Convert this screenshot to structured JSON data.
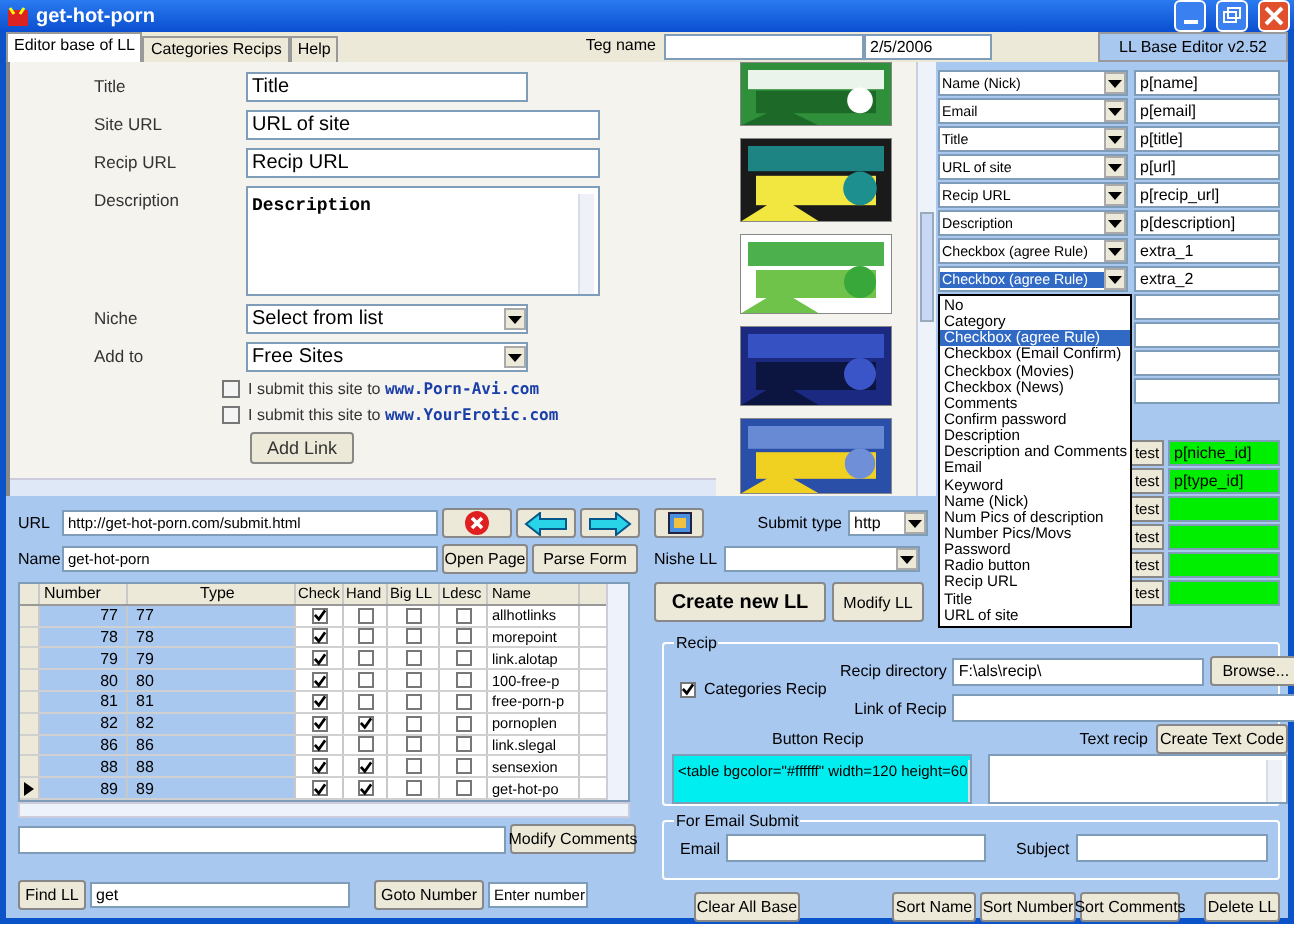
{
  "window": {
    "title": "get-hot-porn"
  },
  "tabs": [
    {
      "label": "Editor base of LL",
      "selected": true
    },
    {
      "label": "Categories Recips",
      "selected": false
    },
    {
      "label": "Help",
      "selected": false
    }
  ],
  "header": {
    "tag_label": "Teg name",
    "date": "2/5/2006",
    "version": "LL Base Editor v2.52"
  },
  "form": {
    "fields": [
      {
        "kind": "input",
        "label": "Title",
        "value": "Title"
      },
      {
        "kind": "wide",
        "label": "Site URL",
        "value": "URL of site"
      },
      {
        "kind": "wide",
        "label": "Recip URL",
        "value": "Recip URL"
      },
      {
        "kind": "textarea",
        "label": "Description",
        "value": "Description"
      },
      {
        "kind": "select",
        "label": "Niche",
        "value": "Select from list"
      },
      {
        "kind": "select",
        "label": "Add to",
        "value": "Free Sites"
      }
    ],
    "submit_options": [
      {
        "text": "I submit this site to **www.Porn-Avi.com**",
        "checked": false
      },
      {
        "text": "I submit this site to **www.YourErotic.com**",
        "checked": false
      }
    ],
    "add_button": "Add Link"
  },
  "banners": [
    {
      "kind": "picture"
    },
    {
      "kind": "picture"
    },
    {
      "kind": "picture"
    },
    {
      "kind": "picture"
    },
    {
      "kind": "picture"
    }
  ],
  "mapping": {
    "rows": [
      {
        "kind": "select",
        "field": "Name (Nick)",
        "param": "p[name]",
        "selected": false
      },
      {
        "kind": "select",
        "field": "Email",
        "param": "p[email]",
        "selected": false
      },
      {
        "kind": "select",
        "field": "Title",
        "param": "p[title]",
        "selected": false
      },
      {
        "kind": "select",
        "field": "URL of site",
        "param": "p[url]",
        "selected": false
      },
      {
        "kind": "select",
        "field": "Recip URL",
        "param": "p[recip_url]",
        "selected": false
      },
      {
        "kind": "select",
        "field": "Description",
        "param": "p[description]",
        "selected": false
      },
      {
        "kind": "select",
        "field": "Checkbox (agree Rule)",
        "param": "extra_1",
        "selected": false
      },
      {
        "kind": "select",
        "field": "Checkbox (agree Rule)",
        "param": "extra_2",
        "selected": true
      },
      {
        "kind": "hidden"
      },
      {
        "kind": "hidden"
      },
      {
        "kind": "hidden"
      },
      {
        "kind": "hidden"
      },
      {
        "kind": "test",
        "button": "test",
        "param": "p[niche_id]"
      },
      {
        "kind": "test",
        "button": "test",
        "param": "p[type_id]"
      },
      {
        "kind": "test",
        "button": "test"
      },
      {
        "kind": "test",
        "button": "test"
      },
      {
        "kind": "test",
        "button": "test"
      },
      {
        "kind": "test",
        "button": "test"
      }
    ],
    "dropdown": [
      {
        "label": "No",
        "selected": false
      },
      {
        "label": "Category",
        "selected": false
      },
      {
        "label": "Checkbox (agree Rule)",
        "selected": true
      },
      {
        "label": "Checkbox (Email Confirm)",
        "selected": false
      },
      {
        "label": "Checkbox (Movies)",
        "selected": false
      },
      {
        "label": "Checkbox (News)",
        "selected": false
      },
      {
        "label": "Comments",
        "selected": false
      },
      {
        "label": "Confirm password",
        "selected": false
      },
      {
        "label": "Description",
        "selected": false
      },
      {
        "label": "Description and Comments",
        "selected": false
      },
      {
        "label": "Email",
        "selected": false
      },
      {
        "label": "Keyword",
        "selected": false
      },
      {
        "label": "Name (Nick)",
        "selected": false
      },
      {
        "label": "Num Pics of description",
        "selected": false
      },
      {
        "label": "Number Pics/Movs",
        "selected": false
      },
      {
        "label": "Password",
        "selected": false
      },
      {
        "label": "Radio button",
        "selected": false
      },
      {
        "label": "Recip URL",
        "selected": false
      },
      {
        "label": "Title",
        "selected": false
      },
      {
        "label": "URL of site",
        "selected": false
      }
    ]
  },
  "url_bar": {
    "url_label": "URL",
    "url": "http://get-hot-porn.com/submit.html",
    "name_label": "Name",
    "name": "get-hot-porn",
    "open_button": "Open Page",
    "parse_button": "Parse Form"
  },
  "table": {
    "columns": [
      "Number",
      "Type",
      "Check",
      "Hand",
      "Big LL",
      "Ldesc",
      "Name"
    ],
    "rows": [
      {
        "number": "77",
        "type": "77",
        "check": true,
        "hand": false,
        "big_ll": false,
        "ldesc": false,
        "name": "allhotlinks",
        "current": false
      },
      {
        "number": "78",
        "type": "78",
        "check": true,
        "hand": false,
        "big_ll": false,
        "ldesc": false,
        "name": "morepoint",
        "current": false
      },
      {
        "number": "79",
        "type": "79",
        "check": true,
        "hand": false,
        "big_ll": false,
        "ldesc": false,
        "name": "link.alotap",
        "current": false
      },
      {
        "number": "80",
        "type": "80",
        "check": true,
        "hand": false,
        "big_ll": false,
        "ldesc": false,
        "name": "100-free-p",
        "current": false
      },
      {
        "number": "81",
        "type": "81",
        "check": true,
        "hand": false,
        "big_ll": false,
        "ldesc": false,
        "name": "free-porn-p",
        "current": false
      },
      {
        "number": "82",
        "type": "82",
        "check": true,
        "hand": true,
        "big_ll": false,
        "ldesc": false,
        "name": "pornoplen",
        "current": false
      },
      {
        "number": "86",
        "type": "86",
        "check": true,
        "hand": false,
        "big_ll": false,
        "ldesc": false,
        "name": "link.slegal",
        "current": false
      },
      {
        "number": "88",
        "type": "88",
        "check": true,
        "hand": true,
        "big_ll": false,
        "ldesc": false,
        "name": "sensexion",
        "current": false
      },
      {
        "number": "89",
        "type": "89",
        "check": true,
        "hand": true,
        "big_ll": false,
        "ldesc": false,
        "name": "get-hot-po",
        "current": true
      }
    ]
  },
  "comments": {
    "button": "Modify Comments"
  },
  "find": {
    "button": "Find LL",
    "value": "get",
    "goto_button": "Goto Number",
    "number_value": "Enter number"
  },
  "submit": {
    "type_label": "Submit type",
    "type": "http",
    "niche_label": "Nishe LL",
    "create_button": "Create new LL",
    "modify_button": "Modify LL"
  },
  "recip": {
    "legend": "Recip",
    "categories_label": "Categories Recip",
    "categories_checked": true,
    "directory_label": "Recip directory",
    "directory": "F:\\als\\recip\\",
    "browse_button": "Browse...",
    "link_label": "Link of Recip",
    "button_label": "Button Recip",
    "button_code": "<table bgcolor=\"#ffffff\" width=120 height=60",
    "text_label": "Text recip",
    "create_text_button": "Create Text Code"
  },
  "email_submit": {
    "legend": "For Email Submit",
    "email_label": "Email",
    "subject_label": "Subject"
  },
  "buttons": [
    "Clear All Base",
    "Sort Name",
    "Sort Number",
    "Sort Comments",
    "Delete LL"
  ]
}
